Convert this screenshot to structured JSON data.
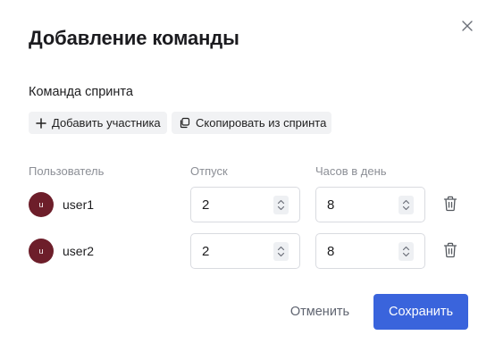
{
  "dialog": {
    "title": "Добавление команды",
    "close_icon": "close-icon"
  },
  "section": {
    "title": "Команда спринта",
    "add_member_label": "Добавить участника",
    "add_member_icon": "plus-icon",
    "copy_label": "Скопировать из спринта",
    "copy_icon": "copy-icon"
  },
  "table": {
    "headers": {
      "user": "Пользователь",
      "vacation": "Отпуск",
      "hours": "Часов в день"
    },
    "rows": [
      {
        "avatar": "u",
        "user": "user1",
        "vacation": "2",
        "hours": "8"
      },
      {
        "avatar": "u",
        "user": "user2",
        "vacation": "2",
        "hours": "8"
      }
    ]
  },
  "footer": {
    "cancel_label": "Отменить",
    "save_label": "Сохранить"
  },
  "colors": {
    "primary": "#3a64dc",
    "avatar": "#6d1e2a"
  }
}
